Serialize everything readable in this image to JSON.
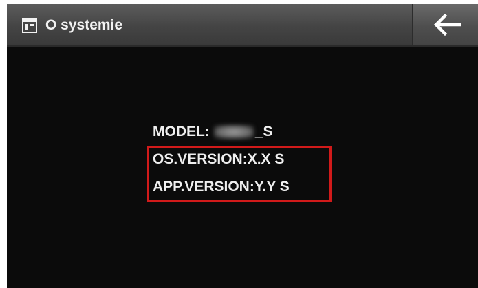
{
  "title_bar": {
    "icon": "window-icon",
    "title": "O systemie",
    "back_icon": "arrow-left-icon"
  },
  "info": {
    "model_label": "MODEL:",
    "model_suffix": "_S",
    "os_version": "OS.VERSION:X.X S",
    "app_version": "APP.VERSION:Y.Y S"
  },
  "colors": {
    "background": "#0b0b0b",
    "title_bar": "#444444",
    "text": "#efefef",
    "highlight": "#d11a1a"
  }
}
